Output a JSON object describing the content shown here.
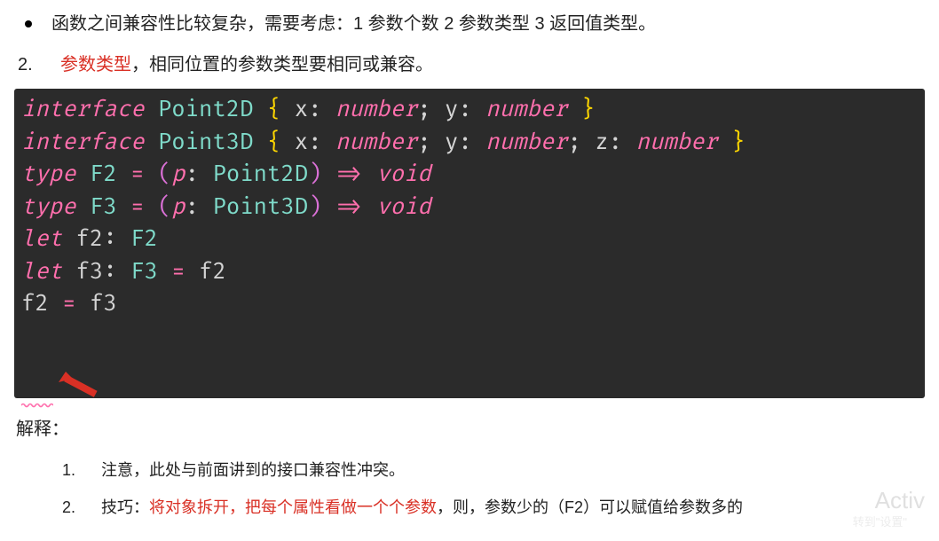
{
  "bullet": {
    "text": "函数之间兼容性比较复杂，需要考虑：1 参数个数 2 参数类型 3 返回值类型。"
  },
  "numItem": {
    "marker": "2.",
    "highlight": "参数类型",
    "rest": "，相同位置的参数类型要相同或兼容。"
  },
  "code": {
    "line1": {
      "kw_interface": "interface",
      "name": "Point2D",
      "x": "x",
      "num1": "number",
      "y": "y",
      "num2": "number"
    },
    "line2": {
      "kw_interface": "interface",
      "name": "Point3D",
      "x": "x",
      "num1": "number",
      "y": "y",
      "num2": "number",
      "z": "z",
      "num3": "number"
    },
    "line3": {
      "kw_type": "type",
      "name": "F2",
      "eq": "=",
      "param": "p",
      "ptype": "Point2D",
      "arrow": "=>",
      "ret": "void"
    },
    "line4": {
      "kw_type": "type",
      "name": "F3",
      "eq": "=",
      "param": "p",
      "ptype": "Point3D",
      "arrow": "=>",
      "ret": "void"
    },
    "line5": {
      "kw_let": "let",
      "var": "f2",
      "type": "F2"
    },
    "line6": {
      "kw_let": "let",
      "var": "f3",
      "type": "F3",
      "eq": "=",
      "val": "f2"
    },
    "line7": {
      "lhs": "f2",
      "eq": "=",
      "rhs": "f3"
    }
  },
  "explain": {
    "title": "解释：",
    "items": [
      {
        "marker": "1.",
        "prefix": "注意",
        "rest": "，此处与前面讲到的接口兼容性冲突。"
      },
      {
        "marker": "2.",
        "prefix": "技巧：",
        "highlight": "将对象拆开，把每个属性看做一个个参数",
        "rest": "，则，参数少的（F2）可以赋值给参数多的"
      }
    ]
  },
  "watermark": {
    "main": "Activ",
    "sub": "转到\"设置\""
  }
}
